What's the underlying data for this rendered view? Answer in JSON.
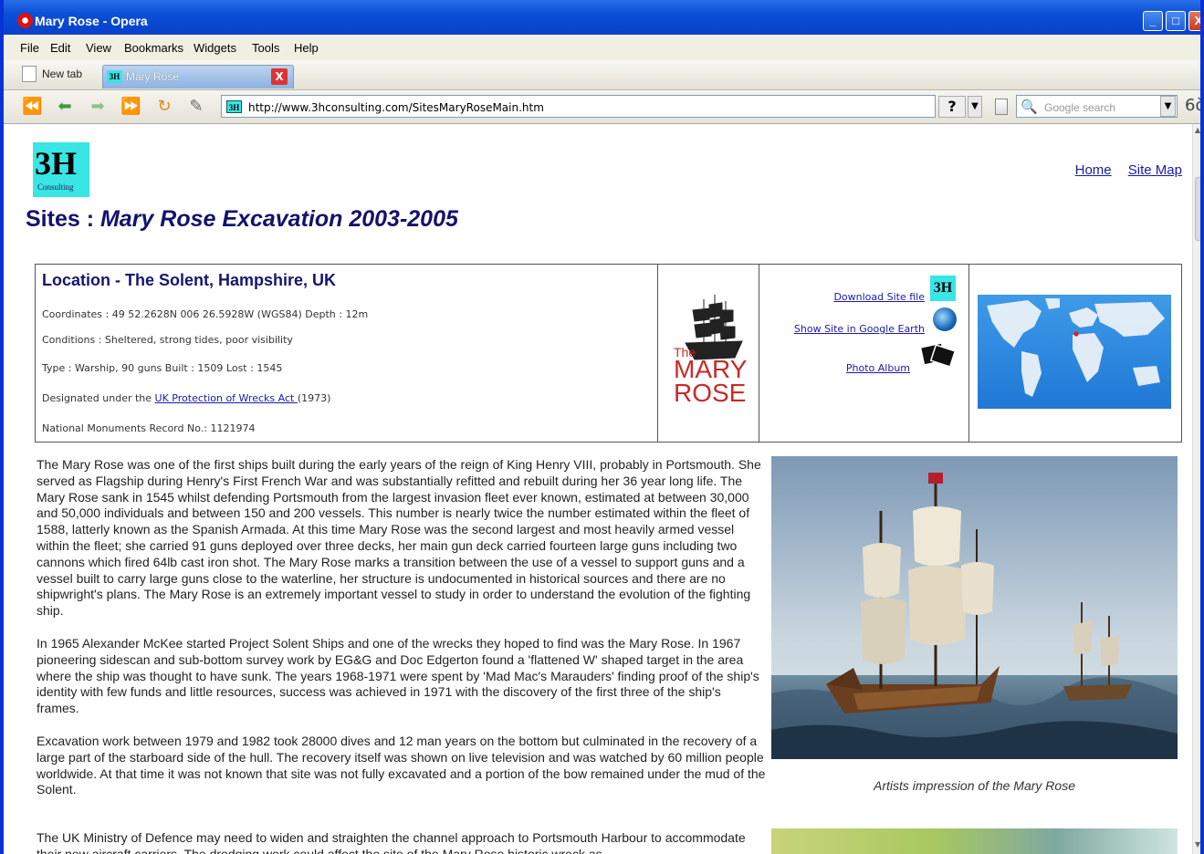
{
  "window": {
    "title": "Mary Rose - Opera",
    "min": "_",
    "max": "□",
    "close": "X"
  },
  "menu": [
    "File",
    "Edit",
    "View",
    "Bookmarks",
    "Widgets",
    "Tools",
    "Help"
  ],
  "tabs": {
    "new_tab": "New tab",
    "active": "Mary Rose",
    "favicon": "3H",
    "close": "X"
  },
  "address": {
    "url": "http://www.3hconsulting.com/SitesMaryRoseMain.htm",
    "help": "?",
    "search_placeholder": "Google search"
  },
  "page": {
    "logo_big": "3H",
    "logo_small": "Consulting",
    "links": {
      "home": "Home",
      "sitemap": "Site Map"
    },
    "title_prefix": "Sites : ",
    "title_italic": "Mary Rose Excavation 2003-2005",
    "location": {
      "title": "Location - The Solent, Hampshire, UK",
      "coordinates": "Coordinates : 49 52.2628N  006 26.5928W (WGS84)    Depth : 12m",
      "conditions": "Conditions : Sheltered, strong tides, poor visibility",
      "type": "Type : Warship, 90 guns    Built : 1509    Lost : 1545",
      "designated_pre": "Designated under the ",
      "designated_link": "UK Protection of Wrecks Act ",
      "designated_post": "(1973)",
      "nmr": "National Monuments Record No.: 1121974"
    },
    "maryrose_logo": {
      "the": "The",
      "mary": "MARY",
      "rose": "ROSE"
    },
    "downloads": {
      "file": "Download Site file",
      "earth": "Show Site in Google Earth",
      "album": "Photo Album",
      "icon3h": "3H"
    },
    "paragraphs": [
      "The Mary Rose was one of the first ships built during the early years of the reign of King Henry VIII, probably in Portsmouth.  She served as Flagship during Henry's First French War and was substantially refitted and rebuilt during her 36 year long life. The Mary Rose sank in 1545 whilst defending Portsmouth from the largest invasion fleet ever known, estimated at between 30,000 and 50,000 individuals and between 150 and 200 vessels. This number is nearly twice the number estimated within the fleet of 1588, latterly known as the Spanish Armada. At this time Mary Rose was the second largest and most heavily armed vessel within the fleet; she carried 91 guns deployed over three decks, her main gun deck carried fourteen large guns including two cannons which fired 64lb cast iron shot.  The Mary Rose marks a transition between the use of a vessel to support guns and a vessel built to carry large guns close to the waterline, her structure is undocumented in historical sources and there are no shipwright's plans.  The Mary Rose is an extremely important vessel to study in order to understand the evolution of the fighting ship.",
      "In 1965 Alexander McKee started Project Solent Ships and one of the wrecks they hoped to find was the Mary Rose.  In 1967 pioneering sidescan and sub-bottom survey work by EG&G and Doc Edgerton found a 'flattened W' shaped target in the area where the ship was thought to have sunk.  The years 1968-1971 were spent by 'Mad Mac's Marauders' finding proof of the ship's identity with few funds and little resources, success was achieved in 1971 with the discovery of the first three of the ship's frames.",
      "Excavation work between 1979 and 1982 took 28000 dives and 12 man years on the bottom but culminated in the recovery of a large part of the starboard side of the hull.  The recovery itself was shown on live television and was watched by 60 million people worldwide.  At that time it was not known that site was not fully excavated and a portion of the bow remained under the mud of the Solent."
    ],
    "para_last": "The UK Ministry of Defence may need to widen and straighten the channel approach to Portsmouth Harbour to accommodate their new aircraft carriers.  The dredging work could affect the site of the Mary Rose historic wreck as",
    "caption": "Artists impression of the Mary Rose"
  }
}
